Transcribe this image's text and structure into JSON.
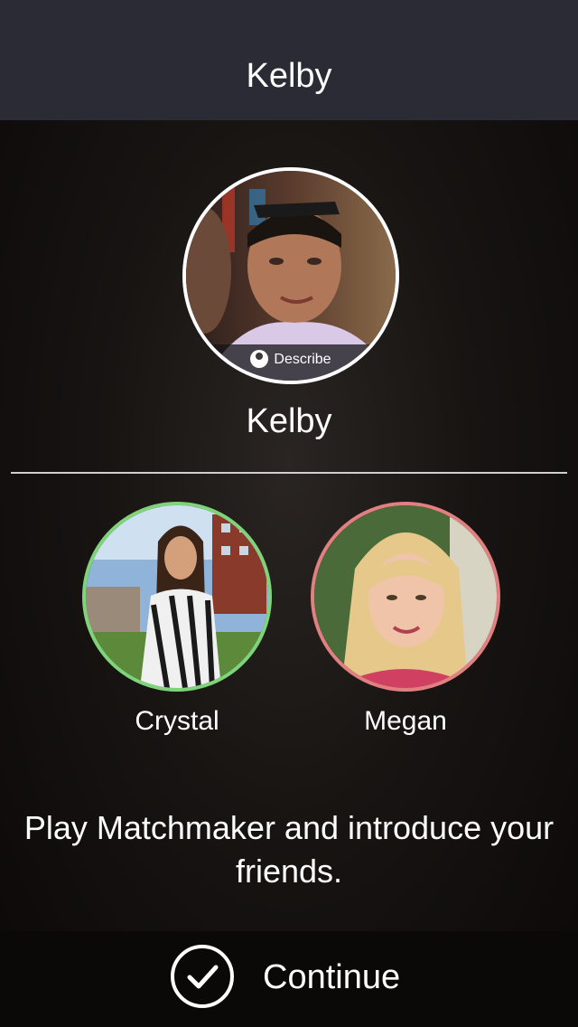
{
  "navbar": {
    "title": "Kelby"
  },
  "profile": {
    "name": "Kelby",
    "avatar_icon": "person-photo",
    "describe_label": "Describe",
    "describe_icon": "person-icon"
  },
  "friends": [
    {
      "name": "Crystal",
      "ring_color": "#7fd47a"
    },
    {
      "name": "Megan",
      "ring_color": "#e27f80"
    }
  ],
  "message": "Play Matchmaker and introduce your friends.",
  "footer": {
    "continue_label": "Continue",
    "continue_icon": "checkmark-icon"
  }
}
